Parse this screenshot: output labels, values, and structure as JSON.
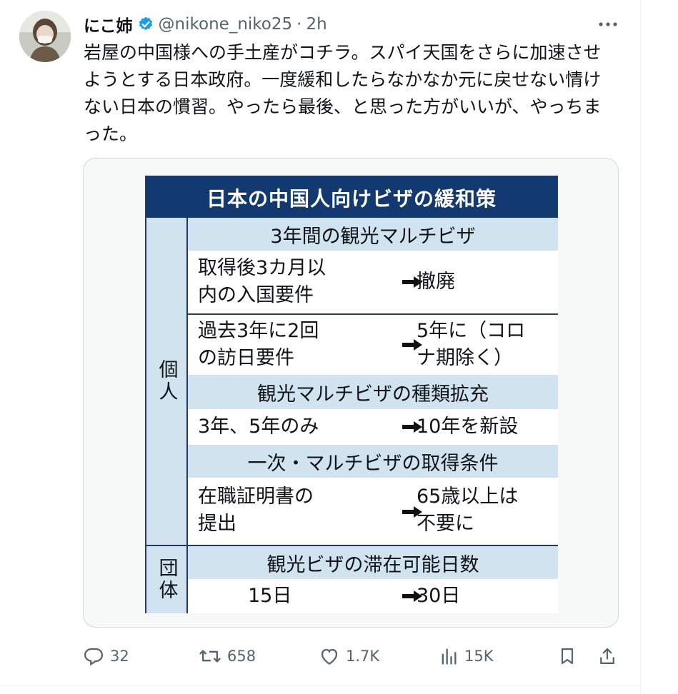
{
  "tweet": {
    "display_name": "にこ姉",
    "handle": "@nikone_niko25",
    "separator": "·",
    "time": "2h",
    "verified_icon": "verified-badge-icon",
    "more_icon": "more-dots-icon",
    "text": "岩屋の中国様への手土産がコチラ。スパイ天国をさらに加速させようとする日本政府。一度緩和したらなかなか元に戻せない情けない日本の慣習。やったら最後、と思った方がいいが、やっちまった。"
  },
  "infographic": {
    "title": "日本の中国人向けビザの緩和策",
    "side_individual": "個人",
    "side_group": "団体",
    "sections": [
      "3年間の観光マルチビザ",
      "観光マルチビザの種類拡充",
      "一次・マルチビザの取得条件",
      "観光ビザの滞在可能日数"
    ],
    "rows": [
      {
        "from": [
          "取得後3カ月以",
          "内の入国要件"
        ],
        "to": [
          "撤廃"
        ]
      },
      {
        "from": [
          "過去3年に2回",
          "の訪日要件"
        ],
        "to": [
          "5年に（コロ",
          "ナ期除く）"
        ]
      },
      {
        "from": [
          "3年、5年のみ"
        ],
        "to": [
          "10年を新設"
        ]
      },
      {
        "from": [
          "在職証明書の",
          "提出"
        ],
        "to": [
          "65歳以上は",
          "不要に"
        ]
      },
      {
        "from": [
          "15日"
        ],
        "to": [
          "30日"
        ]
      }
    ]
  },
  "actions": {
    "reply": {
      "icon": "reply-icon",
      "count": "32"
    },
    "retweet": {
      "icon": "retweet-icon",
      "count": "658"
    },
    "like": {
      "icon": "heart-icon",
      "count": "1.7K"
    },
    "views": {
      "icon": "views-icon",
      "count": "15K"
    },
    "bookmark": {
      "icon": "bookmark-icon"
    },
    "share": {
      "icon": "share-icon"
    }
  },
  "colors": {
    "verified": "#1d9bf0",
    "title_bar": "#123a70",
    "section_bg": "#d2e3f0",
    "muted": "#536471"
  }
}
